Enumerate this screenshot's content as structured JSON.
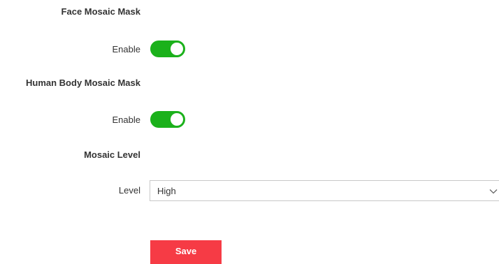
{
  "face_mask": {
    "title": "Face Mosaic Mask",
    "enable_label": "Enable",
    "enabled": true
  },
  "body_mask": {
    "title": "Human Body Mosaic Mask",
    "enable_label": "Enable",
    "enabled": true
  },
  "mosaic_level": {
    "title": "Mosaic Level",
    "level_label": "Level",
    "selected": "High"
  },
  "actions": {
    "save_label": "Save"
  },
  "colors": {
    "toggle_on": "#1bb11b",
    "save_button": "#f63b45"
  },
  "icons": {
    "dropdown": "chevron-down-icon"
  }
}
